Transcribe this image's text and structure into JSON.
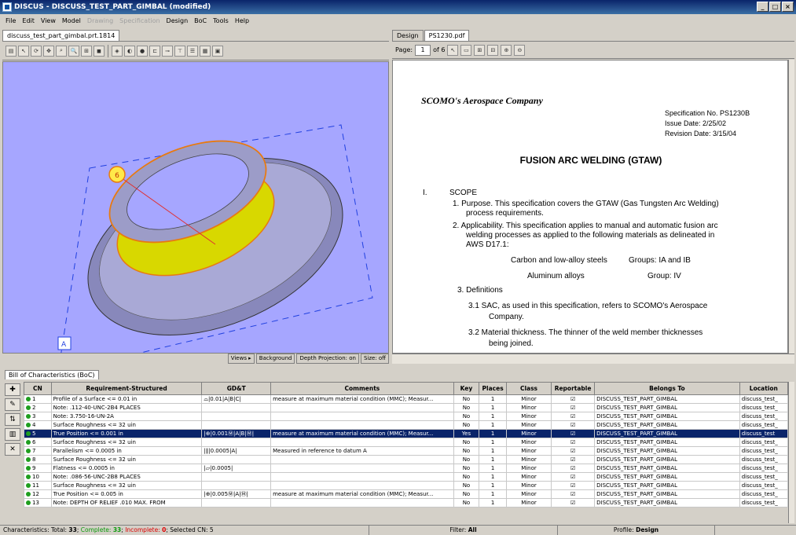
{
  "window": {
    "title": "DISCUS - DISCUSS_TEST_PART_GIMBAL (modified)",
    "minimize": "_",
    "restore": "□",
    "close": "×"
  },
  "menu": [
    {
      "label": "File",
      "enabled": true
    },
    {
      "label": "Edit",
      "enabled": true
    },
    {
      "label": "View",
      "enabled": true
    },
    {
      "label": "Model",
      "enabled": true
    },
    {
      "label": "Drawing",
      "enabled": false
    },
    {
      "label": "Specification",
      "enabled": false
    },
    {
      "label": "Design",
      "enabled": true
    },
    {
      "label": "BoC",
      "enabled": true
    },
    {
      "label": "Tools",
      "enabled": true
    },
    {
      "label": "Help",
      "enabled": true
    }
  ],
  "left_pane": {
    "tab": "discuss_test_part_gimbal.prt.1814",
    "balloon": "6",
    "corner_label": "A",
    "status": {
      "views": "Views ▸",
      "background": "Background",
      "depth": "Depth Projection: on",
      "size": "Size: off"
    },
    "colors": {
      "viewport": "#a6a6ff",
      "highlight": "#e87a10",
      "fill": "#e8e800"
    }
  },
  "right_pane": {
    "tabs": [
      "Design",
      "PS1230.pdf"
    ],
    "page_label": "Page:",
    "page_value": "1",
    "page_of": "of 6",
    "doc": {
      "company": "SCOMO's  Aerospace Company",
      "spec_no": "Specification No.  PS1230B",
      "issue": "Issue Date:  2/25/02",
      "revision": "Revision Date: 3/15/04",
      "title": "FUSION ARC WELDING (GTAW)",
      "section_num": "I.",
      "section": "SCOPE",
      "p1": "1.  Purpose. This specification covers the GTAW (Gas Tungsten Arc Welding)",
      "p1b": "process requirements.",
      "p2": "2.  Applicability. This specification applies to manual and automatic fusion arc",
      "p2b": "welding processes as applied to the following materials as delineated in",
      "p2c": "AWS D17.1:",
      "mat1": "Carbon and low-alloy steels",
      "grp1": "Groups: IA and IB",
      "mat2": "Aluminum alloys",
      "grp2": "Group: IV",
      "p3": "3.  Definitions",
      "d1": "3.1   SAC, as used in this specification, refers to SCOMO's Aerospace",
      "d1b": "Company.",
      "d2": "3.2   Material thickness. The thinner of the weld member thicknesses",
      "d2b": "being joined."
    }
  },
  "boc": {
    "tab": "Bill of Characteristics (BoC)",
    "columns": [
      "CN",
      "Requirement-Structured",
      "GD&T",
      "Comments",
      "Key",
      "Places",
      "Class",
      "Reportable",
      "Belongs To",
      "Location"
    ],
    "rows": [
      {
        "cn": "1",
        "req": "Profile of a Surface <= 0.01 in",
        "gdt": "⌓|0.01|A|B|C|",
        "comments": "measure at maximum material condition (MMC); Measur...",
        "key": "No",
        "places": "1",
        "class": "Minor",
        "rep": "☑",
        "belongs": "DISCUSS_TEST_PART_GIMBAL",
        "loc": "discuss_test_"
      },
      {
        "cn": "2",
        "req": "Note: .112-40-UNC-2B4 PLACES",
        "gdt": "",
        "comments": "",
        "key": "No",
        "places": "1",
        "class": "Minor",
        "rep": "☑",
        "belongs": "DISCUSS_TEST_PART_GIMBAL",
        "loc": "discuss_test_"
      },
      {
        "cn": "3",
        "req": "Note: 3.750-16-UN-2A",
        "gdt": "",
        "comments": "",
        "key": "No",
        "places": "1",
        "class": "Minor",
        "rep": "☑",
        "belongs": "DISCUSS_TEST_PART_GIMBAL",
        "loc": "discuss_test_"
      },
      {
        "cn": "4",
        "req": "Surface Roughness <= 32 uin",
        "gdt": "",
        "comments": "",
        "key": "No",
        "places": "1",
        "class": "Minor",
        "rep": "☑",
        "belongs": "DISCUSS_TEST_PART_GIMBAL",
        "loc": "discuss_test_"
      },
      {
        "cn": "5",
        "req": "True Position <= 0.001 in",
        "gdt": "|⊕|0.001Ⓜ|A|B|Ⓜ|",
        "comments": "measure at maximum material condition (MMC); Measur...",
        "key": "Yes",
        "places": "1",
        "class": "Minor",
        "rep": "☑",
        "belongs": "DISCUSS_TEST_PART_GIMBAL",
        "loc": "discuss_test",
        "selected": true
      },
      {
        "cn": "6",
        "req": "Surface Roughness <= 32 uin",
        "gdt": "",
        "comments": "",
        "key": "No",
        "places": "1",
        "class": "Minor",
        "rep": "☑",
        "belongs": "DISCUSS_TEST_PART_GIMBAL",
        "loc": "discuss_test_"
      },
      {
        "cn": "7",
        "req": "Parallelism <= 0.0005 in",
        "gdt": "|∥|0.0005|A|",
        "comments": "Measured in reference to datum A",
        "key": "No",
        "places": "1",
        "class": "Minor",
        "rep": "☑",
        "belongs": "DISCUSS_TEST_PART_GIMBAL",
        "loc": "discuss_test_"
      },
      {
        "cn": "8",
        "req": "Surface Roughness <= 32 uin",
        "gdt": "",
        "comments": "",
        "key": "No",
        "places": "1",
        "class": "Minor",
        "rep": "☑",
        "belongs": "DISCUSS_TEST_PART_GIMBAL",
        "loc": "discuss_test_"
      },
      {
        "cn": "9",
        "req": "Flatness <= 0.0005 in",
        "gdt": "|⏥|0.0005|",
        "comments": "",
        "key": "No",
        "places": "1",
        "class": "Minor",
        "rep": "☑",
        "belongs": "DISCUSS_TEST_PART_GIMBAL",
        "loc": "discuss_test_"
      },
      {
        "cn": "10",
        "req": "Note: .086-56-UNC-2B8 PLACES",
        "gdt": "",
        "comments": "",
        "key": "No",
        "places": "1",
        "class": "Minor",
        "rep": "☑",
        "belongs": "DISCUSS_TEST_PART_GIMBAL",
        "loc": "discuss_test_"
      },
      {
        "cn": "11",
        "req": "Surface Roughness <= 32 uin",
        "gdt": "",
        "comments": "",
        "key": "No",
        "places": "1",
        "class": "Minor",
        "rep": "☑",
        "belongs": "DISCUSS_TEST_PART_GIMBAL",
        "loc": "discuss_test_"
      },
      {
        "cn": "12",
        "req": "True Position <= 0.005 in",
        "gdt": "|⊕|0.005Ⓜ|A|Ⓜ|",
        "comments": "measure at maximum material condition (MMC); Measur...",
        "key": "No",
        "places": "1",
        "class": "Minor",
        "rep": "☑",
        "belongs": "DISCUSS_TEST_PART_GIMBAL",
        "loc": "discuss_test_"
      },
      {
        "cn": "13",
        "req": "Note: DEPTH OF RELIEF .010 MAX. FROM",
        "gdt": "",
        "comments": "",
        "key": "No",
        "places": "1",
        "class": "Minor",
        "rep": "☑",
        "belongs": "DISCUSS_TEST_PART_GIMBAL",
        "loc": "discuss_test_"
      }
    ]
  },
  "statusbar": {
    "prefix": "Characteristics: Total:",
    "total": "33",
    "complete_label": "Complete:",
    "complete": "33",
    "incomplete_label": "Incomplete:",
    "incomplete": "0",
    "selected": "Selected CN: 5",
    "filter_label": "Filter:",
    "filter": "All",
    "profile_label": "Profile:",
    "profile": "Design"
  }
}
